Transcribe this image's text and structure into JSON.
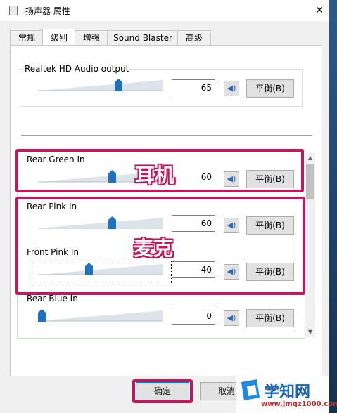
{
  "window": {
    "title": "扬声器 属性",
    "close_glyph": "✕"
  },
  "tabs": [
    "常规",
    "级别",
    "增强",
    "Sound Blaster",
    "高级"
  ],
  "active_tab": "级别",
  "main_device": {
    "label": "Realtek HD Audio output",
    "level": 65,
    "value": "65",
    "balance_label": "平衡(B)"
  },
  "inputs": [
    {
      "label": "Rear Green In",
      "level": 60,
      "value": "60",
      "balance_label": "平衡(B)"
    },
    {
      "label": "Rear Pink In",
      "level": 60,
      "value": "60",
      "balance_label": "平衡(B)"
    },
    {
      "label": "Front Pink In",
      "level": 40,
      "value": "40",
      "balance_label": "平衡(B)"
    },
    {
      "label": "Rear Blue In",
      "level": 0,
      "value": "0",
      "balance_label": "平衡(B)"
    }
  ],
  "annotations": {
    "headphones": "耳机",
    "microphone": "麦克"
  },
  "buttons": {
    "ok": "确定",
    "cancel": "取消"
  },
  "watermark": {
    "brand": "学知网",
    "url": "www.jmqz1000.com"
  },
  "colors": {
    "highlight": "#c2185b",
    "thumb": "#1e73be"
  }
}
